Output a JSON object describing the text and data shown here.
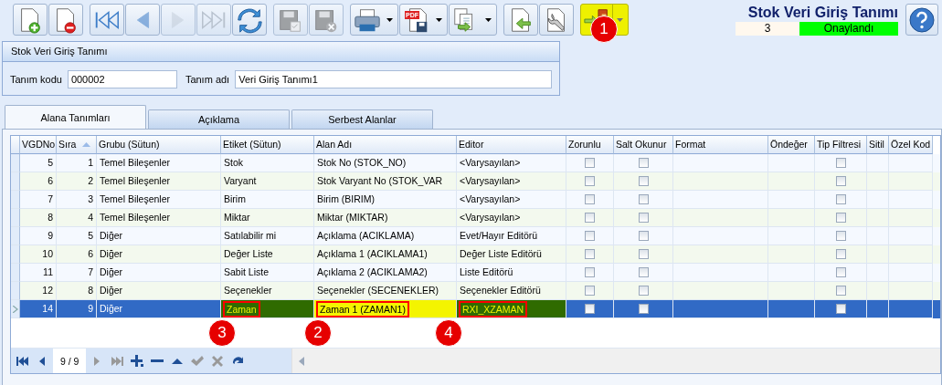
{
  "toolbar": [
    {
      "kind": "new",
      "disabled": false,
      "dropdown": false,
      "highlighted": false
    },
    {
      "kind": "delete",
      "disabled": false,
      "dropdown": false,
      "highlighted": false
    },
    {
      "kind": "first",
      "disabled": false,
      "dropdown": false,
      "highlighted": false
    },
    {
      "kind": "prev",
      "disabled": false,
      "dropdown": false,
      "highlighted": false
    },
    {
      "kind": "next",
      "disabled": true,
      "dropdown": false,
      "highlighted": false
    },
    {
      "kind": "last",
      "disabled": true,
      "dropdown": false,
      "highlighted": false
    },
    {
      "kind": "refresh",
      "disabled": false,
      "dropdown": false,
      "highlighted": false
    },
    {
      "kind": "save",
      "disabled": true,
      "dropdown": false,
      "highlighted": false
    },
    {
      "kind": "save-cancel",
      "disabled": true,
      "dropdown": false,
      "highlighted": false
    },
    {
      "kind": "print",
      "disabled": false,
      "dropdown": true,
      "highlighted": false
    },
    {
      "kind": "pdf",
      "disabled": false,
      "dropdown": true,
      "highlighted": false,
      "badge": "PDF"
    },
    {
      "kind": "export",
      "disabled": false,
      "dropdown": true,
      "highlighted": false
    },
    {
      "kind": "import",
      "disabled": false,
      "dropdown": false,
      "highlighted": false
    },
    {
      "kind": "tools",
      "disabled": false,
      "dropdown": false,
      "highlighted": false
    },
    {
      "kind": "exit",
      "disabled": false,
      "dropdown": true,
      "highlighted": true
    }
  ],
  "header": {
    "title": "Stok Veri Giriş Tanımı",
    "count": "3",
    "status": "Onaylandı"
  },
  "group": {
    "title": "Stok Veri Giriş Tanımı",
    "fields": [
      {
        "label": "Tanım kodu",
        "value": "000002"
      },
      {
        "label": "Tanım adı",
        "value": "Veri Giriş Tanımı1"
      }
    ]
  },
  "tabs": [
    {
      "label": "Alana Tanımları",
      "selected": true
    },
    {
      "label": "Açıklama",
      "selected": false
    },
    {
      "label": "Serbest Alanlar",
      "selected": false
    }
  ],
  "table": {
    "columns": [
      {
        "label": "VGDNo",
        "sorted": false
      },
      {
        "label": "Sıra",
        "sorted": true
      },
      {
        "label": "Grubu (Sütun)",
        "sorted": false
      },
      {
        "label": "Etiket (Sütun)",
        "sorted": false
      },
      {
        "label": "Alan Adı",
        "sorted": false
      },
      {
        "label": "Editor",
        "sorted": false
      },
      {
        "label": "Zorunlu",
        "sorted": false
      },
      {
        "label": "Salt Okunur",
        "sorted": false
      },
      {
        "label": "Format",
        "sorted": false
      },
      {
        "label": "Öndeğer",
        "sorted": false
      },
      {
        "label": "Tip Filtresi",
        "sorted": false
      },
      {
        "label": "Sitil",
        "sorted": false
      },
      {
        "label": "Özel Kod",
        "sorted": false
      }
    ],
    "rows": [
      {
        "vgdno": "5",
        "sira": "1",
        "grubu": "Temel Bileşenler",
        "etiket": "Stok",
        "alan_adi": "Stok No (STOK_NO)",
        "editor": "<Varysayılan>",
        "zorunlu": false,
        "salt_okunur": false,
        "tip_filtresi": false,
        "selected": false
      },
      {
        "vgdno": "6",
        "sira": "2",
        "grubu": "Temel Bileşenler",
        "etiket": "Varyant",
        "alan_adi": "Stok Varyant No (STOK_VAR",
        "editor": "<Varysayılan>",
        "zorunlu": false,
        "salt_okunur": false,
        "tip_filtresi": false,
        "selected": false
      },
      {
        "vgdno": "7",
        "sira": "3",
        "grubu": "Temel Bileşenler",
        "etiket": "Birim",
        "alan_adi": "Birim (BIRIM)",
        "editor": "<Varysayılan>",
        "zorunlu": false,
        "salt_okunur": false,
        "tip_filtresi": false,
        "selected": false
      },
      {
        "vgdno": "8",
        "sira": "4",
        "grubu": "Temel Bileşenler",
        "etiket": "Miktar",
        "alan_adi": "Miktar (MIKTAR)",
        "editor": "<Varysayılan>",
        "zorunlu": false,
        "salt_okunur": false,
        "tip_filtresi": false,
        "selected": false
      },
      {
        "vgdno": "9",
        "sira": "5",
        "grubu": "Diğer",
        "etiket": "Satılabilir mi",
        "alan_adi": "Açıklama (ACIKLAMA)",
        "editor": "Evet/Hayır Editörü",
        "zorunlu": false,
        "salt_okunur": false,
        "tip_filtresi": false,
        "selected": false
      },
      {
        "vgdno": "10",
        "sira": "6",
        "grubu": "Diğer",
        "etiket": "Değer Liste",
        "alan_adi": "Açıklama 1 (ACIKLAMA1)",
        "editor": "Değer Liste Editörü",
        "zorunlu": false,
        "salt_okunur": false,
        "tip_filtresi": false,
        "selected": false
      },
      {
        "vgdno": "11",
        "sira": "7",
        "grubu": "Diğer",
        "etiket": "Sabit Liste",
        "alan_adi": "Açıklama 2 (ACIKLAMA2)",
        "editor": "Liste Editörü",
        "zorunlu": false,
        "salt_okunur": false,
        "tip_filtresi": false,
        "selected": false
      },
      {
        "vgdno": "12",
        "sira": "8",
        "grubu": "Diğer",
        "etiket": "Seçenekler",
        "alan_adi": "Seçenekler (SECENEKLER)",
        "editor": "Seçenekler Editörü",
        "zorunlu": false,
        "salt_okunur": false,
        "tip_filtresi": false,
        "selected": false
      },
      {
        "vgdno": "14",
        "sira": "9",
        "grubu": "Diğer",
        "etiket": "Zaman",
        "alan_adi": "Zaman 1 (ZAMAN1)",
        "editor": "RXI_XZAMAN",
        "zorunlu": false,
        "salt_okunur": false,
        "tip_filtresi": false,
        "selected": true,
        "marked": true
      }
    ]
  },
  "navigator": {
    "buttons": [
      {
        "kind": "first",
        "disabled": false
      },
      {
        "kind": "prev",
        "disabled": false
      }
    ],
    "position": "9 / 9",
    "buttons_after": [
      {
        "kind": "next",
        "disabled": true
      },
      {
        "kind": "last",
        "disabled": true
      },
      {
        "kind": "add",
        "disabled": false
      },
      {
        "kind": "remove",
        "disabled": false
      },
      {
        "kind": "up",
        "disabled": false
      },
      {
        "kind": "confirm",
        "disabled": true
      },
      {
        "kind": "cancel",
        "disabled": true
      },
      {
        "kind": "redo",
        "disabled": false
      }
    ]
  },
  "callouts": [
    {
      "number": "1"
    },
    {
      "number": "3"
    },
    {
      "number": "2"
    },
    {
      "number": "4"
    }
  ]
}
